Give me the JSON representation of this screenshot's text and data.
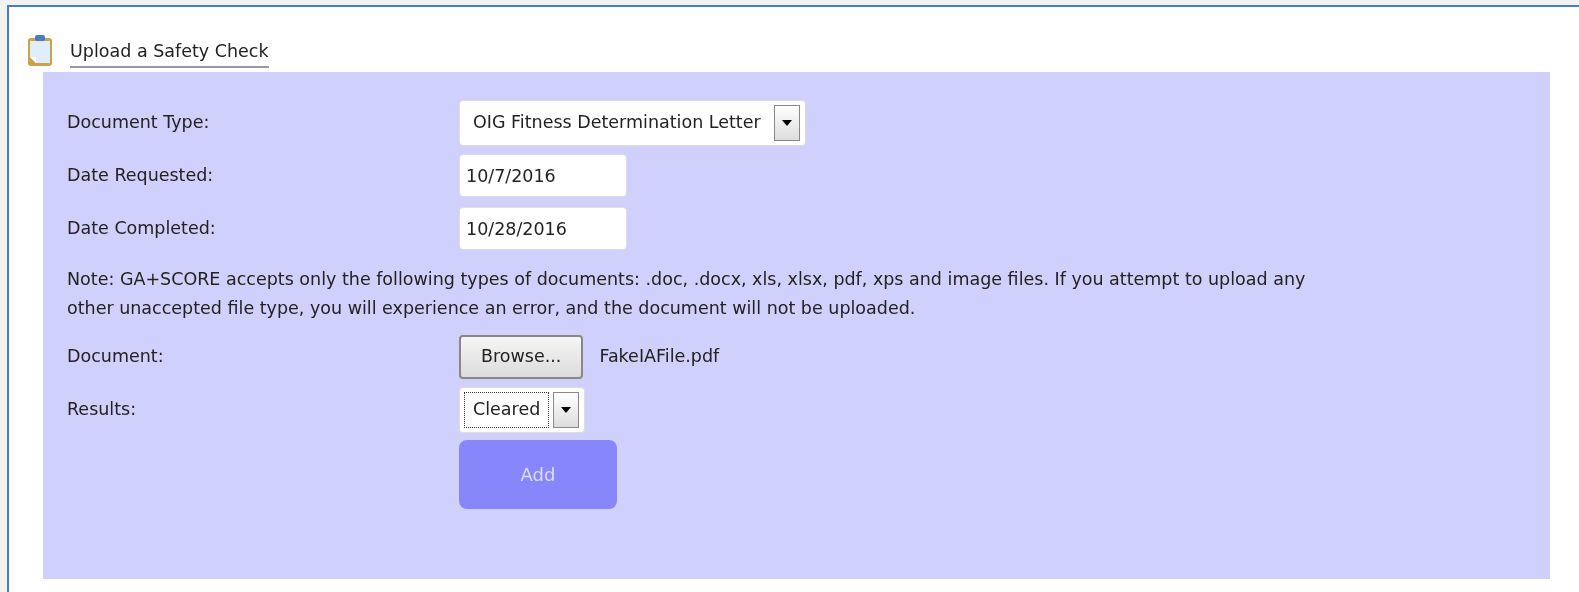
{
  "title": "Upload a Safety Check",
  "fields": [
    {
      "kind": "select",
      "label": "Document Type:",
      "value": "OIG Fitness Determination Letter",
      "focused": false
    },
    {
      "kind": "text",
      "label": "Date Requested:",
      "value": "10/7/2016"
    },
    {
      "kind": "text",
      "label": "Date Completed:",
      "value": "10/28/2016"
    },
    {
      "kind": "note",
      "text": "Note: GA+SCORE accepts only the following types of documents: .doc, .docx, xls, xlsx, pdf, xps and image files. If you attempt to upload any other unaccepted file type, you will experience an error, and the document will not be uploaded."
    },
    {
      "kind": "file",
      "label": "Document:",
      "button": "Browse...",
      "filename": "FakeIAFile.pdf"
    },
    {
      "kind": "select",
      "label": "Results:",
      "value": "Cleared",
      "focused": true
    }
  ],
  "submit": {
    "label": "Add",
    "disabled": true
  }
}
